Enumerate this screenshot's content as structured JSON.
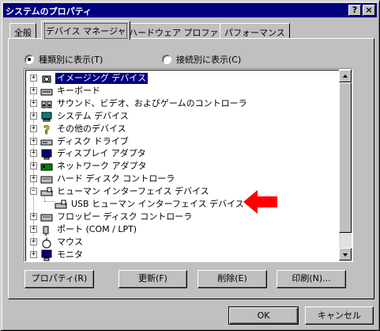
{
  "window": {
    "title": "システムのプロパティ",
    "help_btn": "?",
    "close_btn": "×"
  },
  "tabs": [
    {
      "label": "全般",
      "active": false
    },
    {
      "label": "デバイス マネージャ",
      "active": true
    },
    {
      "label": "ハードウェア プロファイル",
      "active": false
    },
    {
      "label": "パフォーマンス",
      "active": false
    }
  ],
  "view_options": {
    "by_type": "種類別に表示(T)",
    "by_connection": "接続別に表示(C)",
    "selected": "by_type"
  },
  "device_tree": {
    "items": [
      {
        "label": "イメージング デバイス",
        "icon": "camera-icon",
        "expander": "+",
        "selected": true
      },
      {
        "label": "キーボード",
        "icon": "keyboard-icon",
        "expander": "+"
      },
      {
        "label": "サウンド、ビデオ、およびゲームのコントローラ",
        "icon": "sound-icon",
        "expander": "+"
      },
      {
        "label": "システム デバイス",
        "icon": "computer-icon",
        "expander": "+"
      },
      {
        "label": "その他のデバイス",
        "icon": "question-icon",
        "expander": "+"
      },
      {
        "label": "ディスク ドライブ",
        "icon": "disk-drive-icon",
        "expander": "+"
      },
      {
        "label": "ディスプレイ アダプタ",
        "icon": "display-adapter-icon",
        "expander": "+"
      },
      {
        "label": "ネットワーク アダプタ",
        "icon": "network-adapter-icon",
        "expander": "+"
      },
      {
        "label": "ハード ディスク コントローラ",
        "icon": "hdd-controller-icon",
        "expander": "+"
      },
      {
        "label": "ヒューマン インターフェイス デバイス",
        "icon": "hid-icon",
        "expander": "−"
      },
      {
        "label": "USB ヒューマン インターフェイス デバイス",
        "icon": "usb-hid-icon",
        "child": true
      },
      {
        "label": "フロッピー ディスク コントローラ",
        "icon": "floppy-controller-icon",
        "expander": "+"
      },
      {
        "label": "ポート (COM / LPT)",
        "icon": "port-icon",
        "expander": "+"
      },
      {
        "label": "マウス",
        "icon": "mouse-icon",
        "expander": "+"
      },
      {
        "label": "モニタ",
        "icon": "monitor-icon",
        "expander": "+"
      }
    ]
  },
  "actions": {
    "properties": "プロパティ(R)",
    "refresh": "更新(F)",
    "remove": "削除(E)",
    "print": "印刷(N)..."
  },
  "footer": {
    "ok": "OK",
    "cancel": "キャンセル"
  },
  "colors": {
    "title_bg": "#000080",
    "face": "#c0c0c0",
    "selection": "#000080",
    "annotation_arrow": "#ff0000"
  }
}
